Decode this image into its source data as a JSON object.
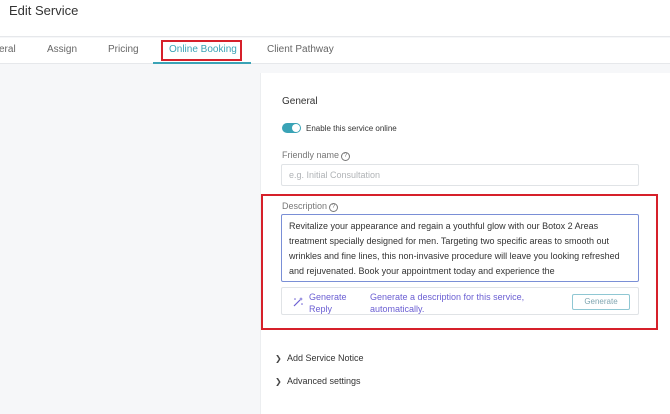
{
  "header": {
    "title": "Edit Service"
  },
  "tabs": [
    {
      "label": "eral"
    },
    {
      "label": "Assign"
    },
    {
      "label": "Pricing"
    },
    {
      "label": "Online Booking"
    },
    {
      "label": "Client Pathway"
    }
  ],
  "general": {
    "title": "General",
    "toggle_label": "Enable this service online",
    "toggle_on": true
  },
  "friendly_name": {
    "label": "Friendly name",
    "placeholder": "e.g. Initial Consultation"
  },
  "description": {
    "label": "Description",
    "value": "Revitalize your appearance and regain a youthful glow with our Botox 2 Areas treatment specially designed for men. Targeting two specific areas to smooth out wrinkles and fine lines, this non-invasive procedure will leave you looking refreshed and rejuvenated. Book your appointment today and experience the"
  },
  "generate": {
    "reply_label": "Generate Reply",
    "hint": "Generate a description for this service, automatically.",
    "button": "Generate"
  },
  "sections": [
    {
      "label": "Add Service Notice"
    },
    {
      "label": "Advanced settings"
    }
  ],
  "icons": {
    "help": "help-icon",
    "wand": "magic-wand-icon",
    "chevron": "chevron-right-icon"
  },
  "colors": {
    "accent": "#3aa3b6",
    "ai_purple": "#6b5fd3",
    "highlight_red": "#d6202a"
  }
}
